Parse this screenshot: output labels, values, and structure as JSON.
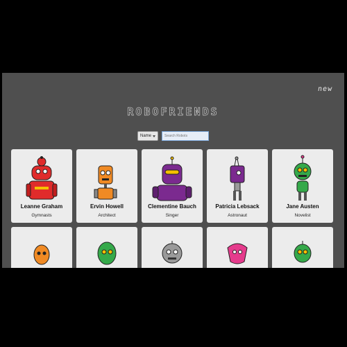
{
  "app": {
    "title": "ROBOFRIENDS",
    "new_link": "new"
  },
  "filter": {
    "select_value": "Name",
    "search_placeholder": "Search Robots"
  },
  "robots": [
    {
      "name": "Leanne Graham",
      "job": "Gymnasts"
    },
    {
      "name": "Ervin Howell",
      "job": "Architect"
    },
    {
      "name": "Clementine Bauch",
      "job": "Singer"
    },
    {
      "name": "Patricia Lebsack",
      "job": "Astronaut"
    },
    {
      "name": "Jane Austen",
      "job": "Novelist"
    }
  ],
  "colors": {
    "background": "#4f4f4f",
    "card": "#ececec",
    "robot_red": "#e02b2b",
    "robot_orange": "#f08a24",
    "robot_purple": "#7b2a8f",
    "robot_green": "#35a94a",
    "robot_gray": "#9a9a9a",
    "robot_pink": "#e53b8c"
  }
}
